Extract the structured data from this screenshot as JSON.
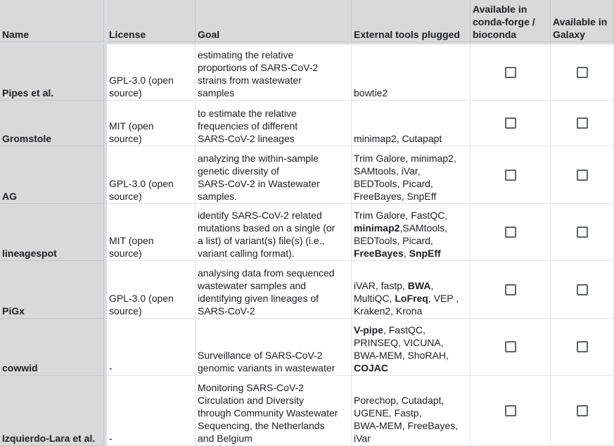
{
  "headers": {
    "name": "Name",
    "license": "License",
    "goal": "Goal",
    "tools": "External tools plugged",
    "conda": [
      "Available in",
      "conda-forge /",
      "bioconda"
    ],
    "galaxy": [
      "Available in",
      "Galaxy"
    ]
  },
  "rows": [
    {
      "name": "Pipes et al.",
      "license": [
        "GPL-3.0 (open",
        "source)"
      ],
      "goal": [
        "estimating the relative",
        "proportions of SARS-CoV-2",
        "strains from wastewater",
        "samples"
      ],
      "tools": [
        [
          {
            "t": "bowtie2",
            "b": false
          }
        ]
      ]
    },
    {
      "name": "Gromstole",
      "license": [
        "MIT (open",
        "source)"
      ],
      "goal": [
        "to estimate the relative",
        "frequencies of different",
        "SARS-CoV-2 lineages"
      ],
      "tools": [
        [
          {
            "t": "minimap2, Cutapapt",
            "b": false
          }
        ]
      ]
    },
    {
      "name": "AG",
      "license": [
        "GPL-3.0 (open",
        "source)"
      ],
      "goal": [
        "analyzing the within-sample",
        "genetic diversity of",
        "SARS-CoV-2 in Wastewater",
        "samples."
      ],
      "tools": [
        [
          {
            "t": "Trim Galore, minimap2,",
            "b": false
          }
        ],
        [
          {
            "t": "SAMtools, iVar,",
            "b": false
          }
        ],
        [
          {
            "t": "BEDTools, Picard,",
            "b": false
          }
        ],
        [
          {
            "t": "FreeBayes, SnpEff",
            "b": false
          }
        ]
      ]
    },
    {
      "name": "lineagespot",
      "license": [
        "MIT (open",
        "source)"
      ],
      "goal": [
        "identify SARS-CoV-2 related",
        "mutations based on a single (or",
        "a list) of variant(s) file(s) (i.e.,",
        "variant calling format)."
      ],
      "tools": [
        [
          {
            "t": "Trim Galore, FastQC,",
            "b": false
          }
        ],
        [
          {
            "t": "minimap2",
            "b": true
          },
          {
            "t": ",SAMtools,",
            "b": false
          }
        ],
        [
          {
            "t": "BEDTools, Picard,",
            "b": false
          }
        ],
        [
          {
            "t": "FreeBayes",
            "b": true
          },
          {
            "t": ", ",
            "b": false
          },
          {
            "t": "SnpEff",
            "b": true
          }
        ]
      ]
    },
    {
      "name": "PiGx",
      "license": [
        "GPL-3.0 (open",
        "source)"
      ],
      "goal": [
        "analysing data from sequenced",
        "wastewater samples and",
        "identifying given lineages of",
        "SARS-CoV-2"
      ],
      "tools": [
        [
          {
            "t": "iVAR, fastp, ",
            "b": false
          },
          {
            "t": "BWA",
            "b": true
          },
          {
            "t": ",",
            "b": false
          }
        ],
        [
          {
            "t": "MultiQC, ",
            "b": false
          },
          {
            "t": "LoFreq",
            "b": true
          },
          {
            "t": ", VEP ,",
            "b": false
          }
        ],
        [
          {
            "t": "Kraken2, Krona",
            "b": false
          }
        ]
      ]
    },
    {
      "name": "cowwid",
      "license": [
        "-"
      ],
      "goal": [
        "Surveillance of SARS-CoV-2",
        "genomic variants in wastewater"
      ],
      "tools": [
        [
          {
            "t": "V-pipe",
            "b": true
          },
          {
            "t": ", FastQC,",
            "b": false
          }
        ],
        [
          {
            "t": "PRINSEQ, VICUNA,",
            "b": false
          }
        ],
        [
          {
            "t": "BWA-MEM, ShoRAH,",
            "b": false
          }
        ],
        [
          {
            "t": "COJAC",
            "b": true
          }
        ]
      ]
    },
    {
      "name": "Izquierdo-Lara et al.",
      "license": [
        "-"
      ],
      "goal": [
        "Monitoring SARS-CoV-2",
        "Circulation and Diversity",
        "through Community Wastewater",
        "Sequencing, the Netherlands",
        "and Belgium"
      ],
      "tools": [
        [
          {
            "t": "Porechop, Cutadapt,",
            "b": false
          }
        ],
        [
          {
            "t": "UGENE, Fastp,",
            "b": false
          }
        ],
        [
          {
            "t": "BWA-MEM, FreeBayes,",
            "b": false
          }
        ],
        [
          {
            "t": "iVar",
            "b": false
          }
        ]
      ]
    }
  ]
}
